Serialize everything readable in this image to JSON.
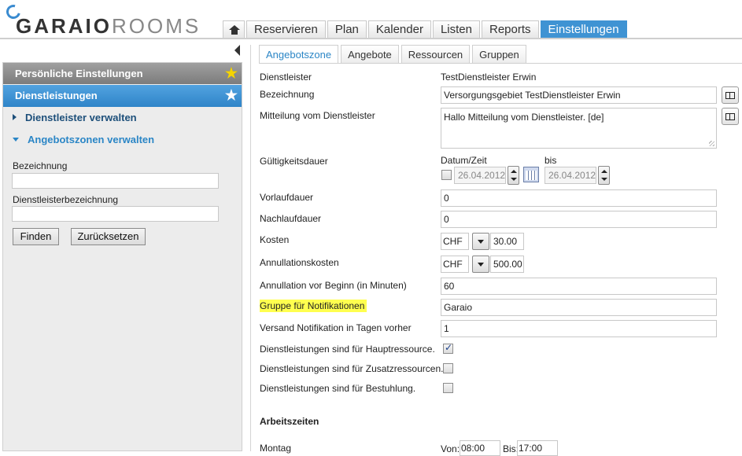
{
  "logo": {
    "part1": "GARAIO",
    "part2": "ROOMS"
  },
  "nav": {
    "home_icon": "home-icon",
    "items": [
      "Reservieren",
      "Plan",
      "Kalender",
      "Listen",
      "Reports",
      "Einstellungen"
    ],
    "active": "Einstellungen"
  },
  "sidebar": {
    "sections": [
      {
        "label": "Persönliche Einstellungen",
        "icon": "star-yellow-icon"
      },
      {
        "label": "Dienstleistungen",
        "icon": "star-white-icon"
      }
    ],
    "subitems": [
      {
        "label": "Dienstleister verwalten"
      },
      {
        "label": "Angebotszonen verwalten"
      }
    ],
    "search": {
      "bezeichnung_label": "Bezeichnung",
      "bezeichnung_value": "",
      "dienstleister_label": "Dienstleisterbezeichnung",
      "dienstleister_value": "",
      "find_label": "Finden",
      "reset_label": "Zurücksetzen"
    }
  },
  "tabs": [
    "Angebotszone",
    "Angebote",
    "Ressourcen",
    "Gruppen"
  ],
  "active_tab": "Angebotszone",
  "form": {
    "dienstleister": {
      "label": "Dienstleister",
      "value": "TestDienstleister Erwin"
    },
    "bezeichnung": {
      "label": "Bezeichnung",
      "value": "Versorgungsgebiet TestDienstleister Erwin"
    },
    "mitteilung": {
      "label": "Mitteilung vom Dienstleister",
      "value": "Hallo Mitteilung vom Dienstleister. [de]"
    },
    "gueltigkeit": {
      "label": "Gültigkeitsdauer",
      "datum_label": "Datum/Zeit",
      "bis_label": "bis",
      "from": "26.04.2012",
      "to": "26.04.2012",
      "checked": false
    },
    "vorlauf": {
      "label": "Vorlaufdauer",
      "value": "0"
    },
    "nachlauf": {
      "label": "Nachlaufdauer",
      "value": "0"
    },
    "kosten": {
      "label": "Kosten",
      "currency": "CHF",
      "value": "30.00"
    },
    "annullationskosten": {
      "label": "Annullationskosten",
      "currency": "CHF",
      "value": "500.00"
    },
    "annullation_minuten": {
      "label": "Annullation vor Beginn (in Minuten)",
      "value": "60"
    },
    "gruppe": {
      "label": "Gruppe für Notifikationen",
      "value": "Garaio"
    },
    "versand": {
      "label": "Versand Notifikation in Tagen vorher",
      "value": "1"
    },
    "haupt": {
      "label": "Dienstleistungen sind für Hauptressource.",
      "checked": true
    },
    "zusatz": {
      "label": "Dienstleistungen sind für Zusatzressourcen.",
      "checked": false
    },
    "bestuhlung": {
      "label": "Dienstleistungen sind für Bestuhlung.",
      "checked": false
    },
    "arbeitszeiten": {
      "label": "Arbeitszeiten"
    },
    "montag": {
      "label": "Montag",
      "von_label": "Von:",
      "von": "08:00",
      "bis_label": "Bis:",
      "bis": "17:00"
    }
  }
}
